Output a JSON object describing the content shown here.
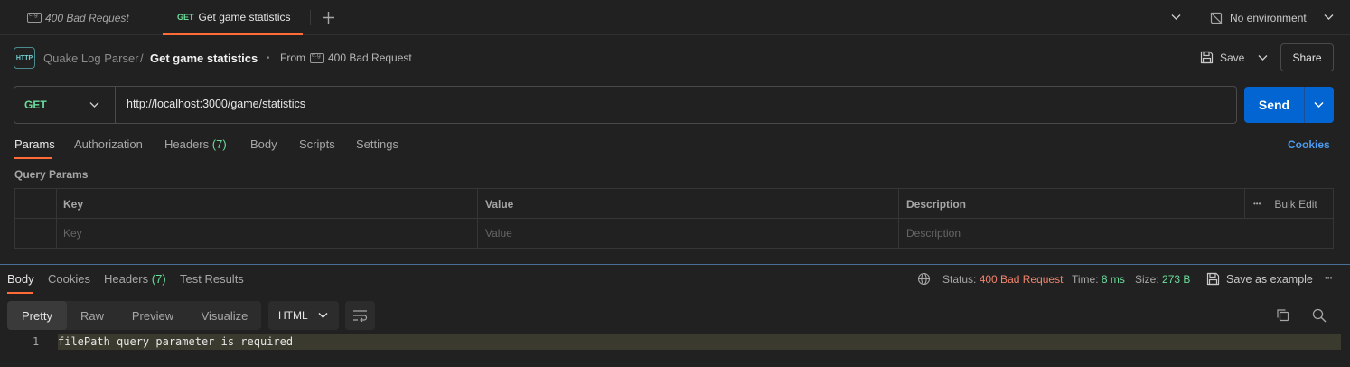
{
  "colors": {
    "accent": "#ff6c37",
    "method_get": "#6bdd9a",
    "send_button": "#0265d2",
    "cookies_link": "#4c9bf1",
    "status_error": "#f1846d",
    "time_ok": "#6bdd9a",
    "background": "#212121"
  },
  "tabs": {
    "tab1_label": "400 Bad Request",
    "tab2_method": "GET",
    "tab2_label": "Get game statistics"
  },
  "environment": {
    "label": "No environment"
  },
  "breadcrumb": {
    "collection": "Quake Log Parser",
    "separator": "/",
    "request": "Get game statistics",
    "dot": "•",
    "from_label": "From",
    "from_example": "400 Bad Request",
    "http_icon_text": "HTTP"
  },
  "toolbar": {
    "save_label": "Save",
    "share_label": "Share"
  },
  "request": {
    "method": "GET",
    "url": "http://localhost:3000/game/statistics",
    "send_label": "Send"
  },
  "request_tabs": {
    "params": "Params",
    "authorization": "Authorization",
    "headers": "Headers",
    "headers_count": "(7)",
    "body": "Body",
    "scripts": "Scripts",
    "settings": "Settings",
    "cookies": "Cookies"
  },
  "query_params": {
    "title": "Query Params",
    "columns": [
      "Key",
      "Value",
      "Description"
    ],
    "bulk_edit": "Bulk Edit",
    "more": "•••",
    "placeholders": {
      "key": "Key",
      "value": "Value",
      "description": "Description"
    }
  },
  "response_tabs": {
    "body": "Body",
    "cookies": "Cookies",
    "headers": "Headers",
    "headers_count": "(7)",
    "test_results": "Test Results"
  },
  "response_meta": {
    "status_label": "Status:",
    "status_value": "400 Bad Request",
    "time_label": "Time:",
    "time_value": "8 ms",
    "size_label": "Size:",
    "size_value": "273 B",
    "save_example": "Save as example",
    "more": "•••"
  },
  "view_modes": {
    "pretty": "Pretty",
    "raw": "Raw",
    "preview": "Preview",
    "visualize": "Visualize",
    "selected": "Pretty"
  },
  "format": {
    "selected": "HTML"
  },
  "response_body": {
    "line_number": "1",
    "text": "filePath query parameter is required"
  }
}
